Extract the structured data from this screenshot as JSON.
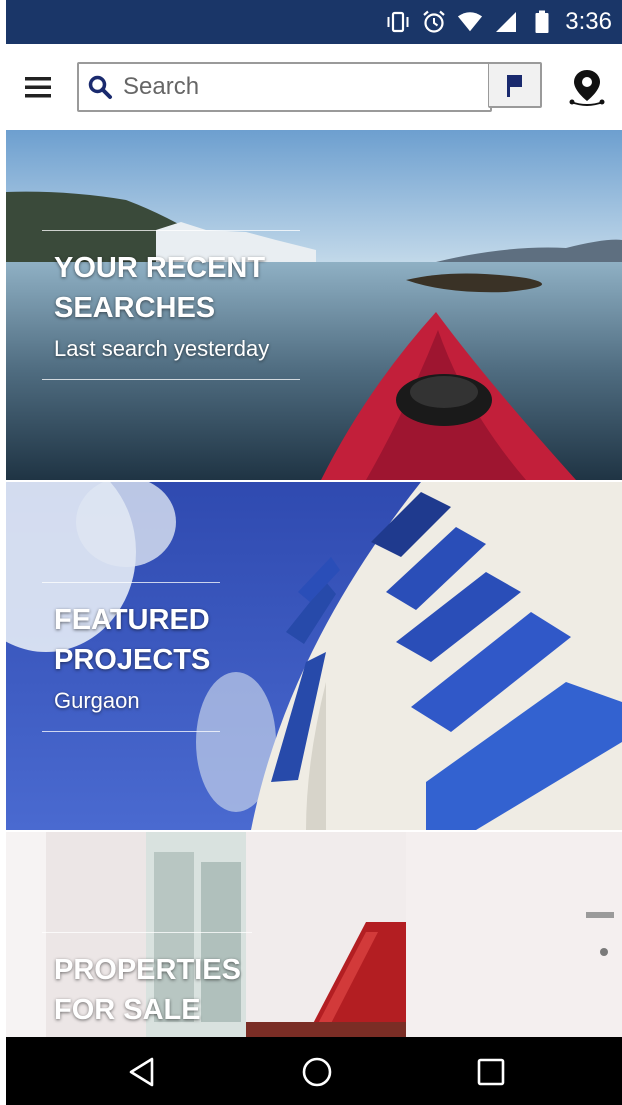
{
  "status_bar": {
    "time": "3:36",
    "icons": [
      "vibrate-icon",
      "alarm-icon",
      "wifi-icon",
      "signal-icon",
      "battery-icon"
    ]
  },
  "toolbar": {
    "menu_icon": "hamburger-menu-icon",
    "search": {
      "placeholder": "Search",
      "value": ""
    },
    "flag_icon": "flag-icon",
    "location_icon": "map-pin-icon"
  },
  "tiles": [
    {
      "title_line1": "YOUR RECENT",
      "title_line2": "SEARCHES",
      "subtitle": "Last search yesterday"
    },
    {
      "title_line1": "FEATURED",
      "title_line2": "PROJECTS",
      "subtitle": "Gurgaon"
    },
    {
      "title_line1": "PROPERTIES",
      "title_line2": "FOR SALE",
      "subtitle": ""
    }
  ],
  "nav_bar": {
    "icons": [
      "back-icon",
      "home-icon",
      "recents-icon"
    ]
  },
  "colors": {
    "status_bar": "#1a3668",
    "nav_bar": "#000000",
    "flag": "#1a2a6e"
  }
}
